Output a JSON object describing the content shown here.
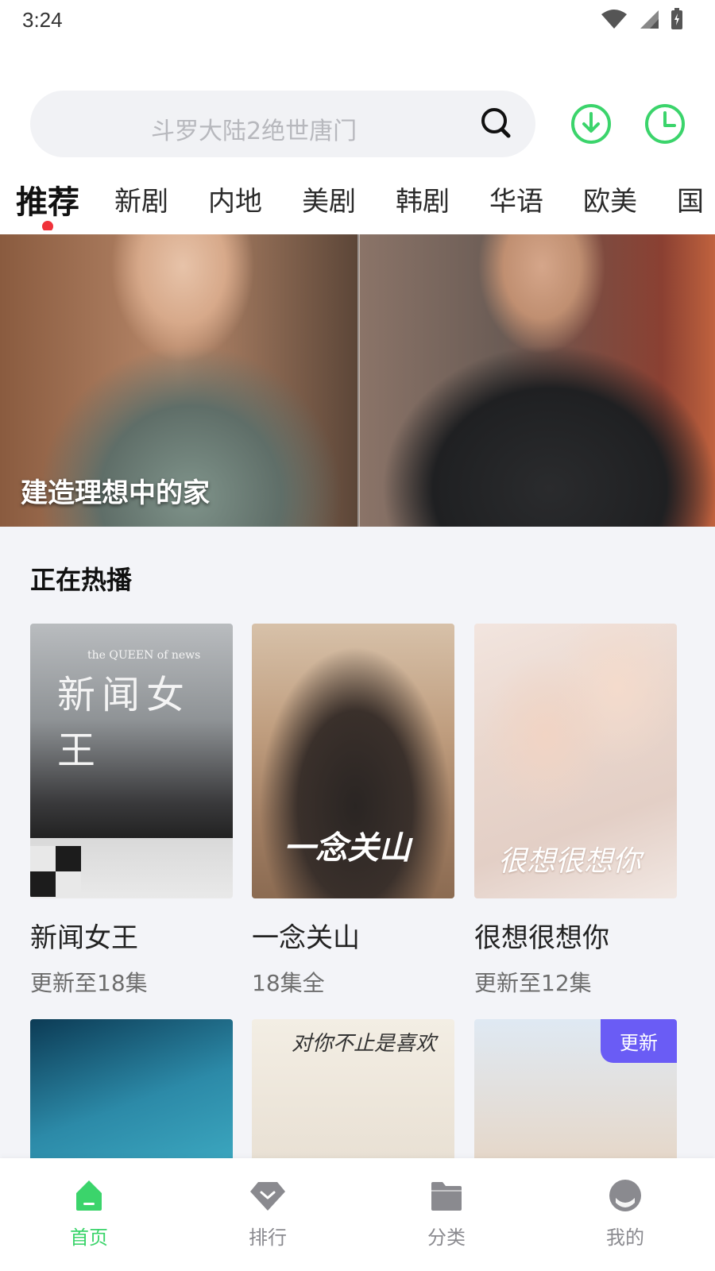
{
  "status_bar": {
    "time": "3:24"
  },
  "search": {
    "placeholder": "斗罗大陆2绝世唐门"
  },
  "tabs": [
    "推荐",
    "新剧",
    "内地",
    "美剧",
    "韩剧",
    "华语",
    "欧美",
    "国"
  ],
  "banner": {
    "caption": "建造理想中的家"
  },
  "section": {
    "title": "正在热播"
  },
  "shows": [
    {
      "title": "新闻女王",
      "subtitle": "更新至18集",
      "poster_text": "新闻女王",
      "poster_sub": "the QUEEN of news"
    },
    {
      "title": "一念关山",
      "subtitle": "18集全",
      "poster_text": "一念关山"
    },
    {
      "title": "很想很想你",
      "subtitle": "更新至12集",
      "poster_text": "很想很想你"
    }
  ],
  "shows_row2": [
    {
      "poster_text": ""
    },
    {
      "poster_text": "对你不止是喜欢"
    },
    {
      "badge": "更新"
    }
  ],
  "bottom_nav": [
    {
      "label": "首页",
      "active": true
    },
    {
      "label": "排行",
      "active": false
    },
    {
      "label": "分类",
      "active": false
    },
    {
      "label": "我的",
      "active": false
    }
  ],
  "colors": {
    "accent_green": "#3bd46b",
    "tab_dot_red": "#f0323a",
    "badge_purple": "#6a5cf5"
  },
  "icons": {
    "status": [
      "wifi-icon",
      "signal-icon",
      "battery-icon"
    ],
    "header": [
      "search-icon",
      "download-icon",
      "history-icon"
    ],
    "nav": [
      "home-icon",
      "ranking-icon",
      "folder-icon",
      "profile-icon"
    ]
  }
}
